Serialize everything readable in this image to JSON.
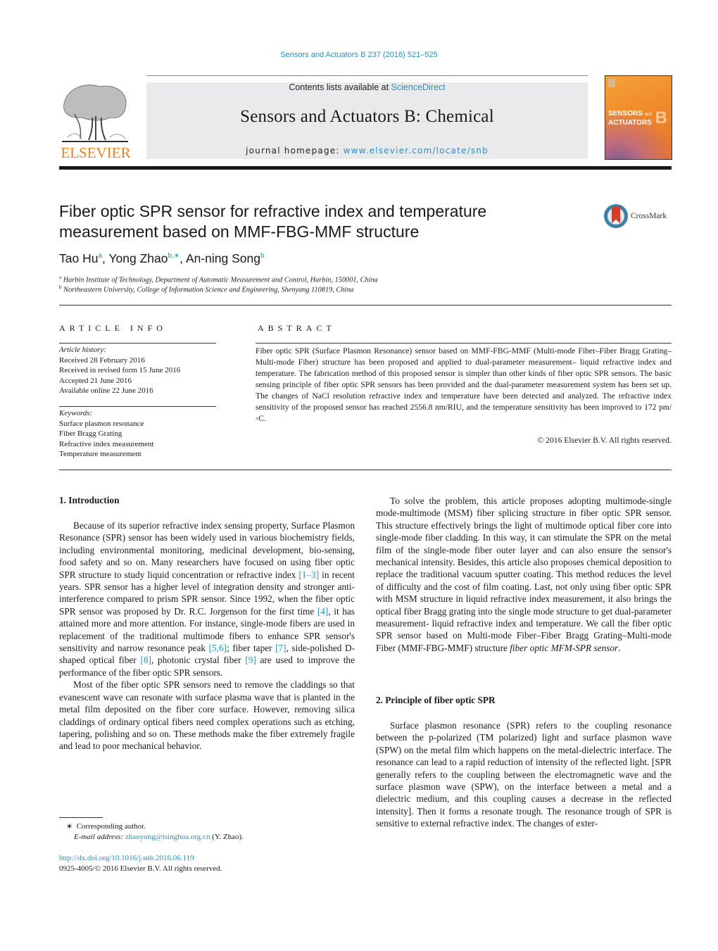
{
  "running_head": "Sensors and Actuators B 237 (2016) 521–525",
  "masthead": {
    "contents_prefix": "Contents lists available at ",
    "contents_link": "ScienceDirect",
    "journal_title": "Sensors and Actuators B: Chemical",
    "homepage_prefix": "journal homepage: ",
    "homepage_link": "www.elsevier.com/locate/snb"
  },
  "publisher_logo": {
    "wordmark": "ELSEVIER",
    "color": "#f07f1e"
  },
  "cover": {
    "line1": "SENSORS",
    "line1_small": "and",
    "line2": "ACTUATORS",
    "letter": "B"
  },
  "crossmark": {
    "label": "CrossMark"
  },
  "article": {
    "title_line1": "Fiber optic SPR sensor for refractive index and temperature",
    "title_line2": "measurement based on MMF-FBG-MMF structure",
    "authors": [
      {
        "name": "Tao Hu",
        "sup": "a"
      },
      {
        "name": "Yong Zhao",
        "sup": "b,∗"
      },
      {
        "name": "An-ning Song",
        "sup": "b"
      }
    ],
    "affiliations": [
      {
        "sup": "a",
        "text": "Harbin Institute of Technology, Department of Automatic Measurement and Control, Harbin, 150001, China"
      },
      {
        "sup": "b",
        "text": "Northeastern University, College of Information Science and Engineering, Shenyang 110819, China"
      }
    ]
  },
  "article_info": {
    "heading": "ARTICLE INFO",
    "history_label": "Article history:",
    "history": [
      "Received 28 February 2016",
      "Received in revised form 15 June 2016",
      "Accepted 21 June 2016",
      "Available online 22 June 2016"
    ],
    "keywords_label": "Keywords:",
    "keywords": [
      "Surface plasmon resonance",
      "Fiber Bragg Grating",
      "Refractive index measurement",
      "Temperature measurement"
    ]
  },
  "abstract": {
    "heading": "ABSTRACT",
    "text": "Fiber optic SPR (Surface Plasmon Resonance) sensor based on MMF-FBG-MMF (Multi-mode Fiber–Fiber Bragg Grating–Multi-mode Fiber) structure has been proposed and applied to dual-parameter measurement– liquid refractive index and temperature. The fabrication method of this proposed sensor is simpler than other kinds of fiber optic SPR sensors. The basic sensing principle of fiber optic SPR sensors has been provided and the dual-parameter measurement system has been set up. The changes of NaCl resolution refractive index and temperature have been detected and analyzed. The refractive index sensitivity of the proposed sensor has reached 2556.8 nm/RIU, and the temperature sensitivity has been improved to 172 pm/◦C.",
    "copyright": "© 2016 Elsevier B.V. All rights reserved."
  },
  "body": {
    "sec1_title": "1.  Introduction",
    "sec1_p1_parts": [
      "Because of its superior refractive index sensing property, Surface Plasmon Resonance (SPR) sensor has been widely used in various biochemistry fields, including environmental monitoring, medicinal development, bio-sensing, food safety and so on. Many researchers have focused on using fiber optic SPR structure to study liquid concentration or refractive index ",
      "[1–3]",
      " in recent years. SPR sensor has a higher level of integration density and stronger anti-interference compared to prism SPR sensor. Since 1992, when the fiber optic SPR sensor was proposed by Dr. R.C. Jorgenson for the first time ",
      "[4]",
      ", it has attained more and more attention. For instance, single-mode fibers are used in replacement of the traditional multimode fibers to enhance SPR sensor's sensitivity and narrow resonance peak ",
      "[5,6]",
      "; fiber taper ",
      "[7]",
      ", side-polished D-shaped optical fiber ",
      "[8]",
      ", photonic crystal fiber ",
      "[9]",
      " are used to improve the performance of the fiber optic SPR sensors."
    ],
    "sec1_p2": "Most of the fiber optic SPR sensors need to remove the claddings so that evanescent wave can resonate with surface plasma wave that is planted in the metal film deposited on the fiber core surface. However, removing silica claddings of ordinary optical fibers need complex operations such as etching, tapering, polishing and so on. These methods make the fiber extremely fragile and lead to poor mechanical behavior.",
    "sec1_p3": "To solve the problem, this article proposes adopting multimode-single mode-multimode (MSM) fiber splicing structure in fiber optic SPR sensor. This structure effectively brings the light of multimode optical fiber core into single-mode fiber cladding. In this way, it can stimulate the SPR on the metal film of the single-mode fiber outer layer and can also ensure the sensor's mechanical intensity. Besides, this article also proposes chemical deposition to replace the traditional vacuum sputter coating. This method reduces the level of difficulty and the cost of film coating. Last, not only using fiber optic SPR with MSM structure in liquid refractive index measurement, it also brings the optical fiber Bragg grating into the single mode structure to get dual-parameter measurement- liquid refractive index and temperature. We call the fiber optic SPR sensor based on Multi-mode Fiber–Fiber Bragg Grating–Multi-mode Fiber (MMF-FBG-MMF) structure ",
    "sec1_p3_em": "fiber optic MFM-SPR sensor",
    "sec1_p3_end": ".",
    "sec2_title": "2.  Principle of fiber optic SPR",
    "sec2_p1": "Surface plasmon resonance (SPR) refers to the coupling resonance between the p-polarized (TM polarized) light and surface plasmon wave (SPW) on the metal film which happens on the metal-dielectric interface. The resonance can lead to a rapid reduction of intensity of the reflected light. [SPR generally refers to the coupling between the electromagnetic wave and the surface plasmon wave (SPW), on the interface between a metal and a dielectric medium, and this coupling causes a decrease in the reflected intensity]. Then it forms a resonate trough. The resonance trough of SPR is sensitive to external refractive index. The changes of exter-"
  },
  "footnote": {
    "marker": "∗",
    "corresponding": "Corresponding author.",
    "email_label": "E-mail address:",
    "email": "zhaoyong@tsinghua.org.cn",
    "email_suffix": " (Y. Zhao)."
  },
  "doi": "http://dx.doi.org/10.1016/j.snb.2016.06.119",
  "issn_line": "0925-4005/© 2016 Elsevier B.V. All rights reserved.",
  "colors": {
    "link": "#2a8fbf",
    "masthead_bg": "#e9eaeb",
    "elsevier_orange": "#f07f1e"
  }
}
